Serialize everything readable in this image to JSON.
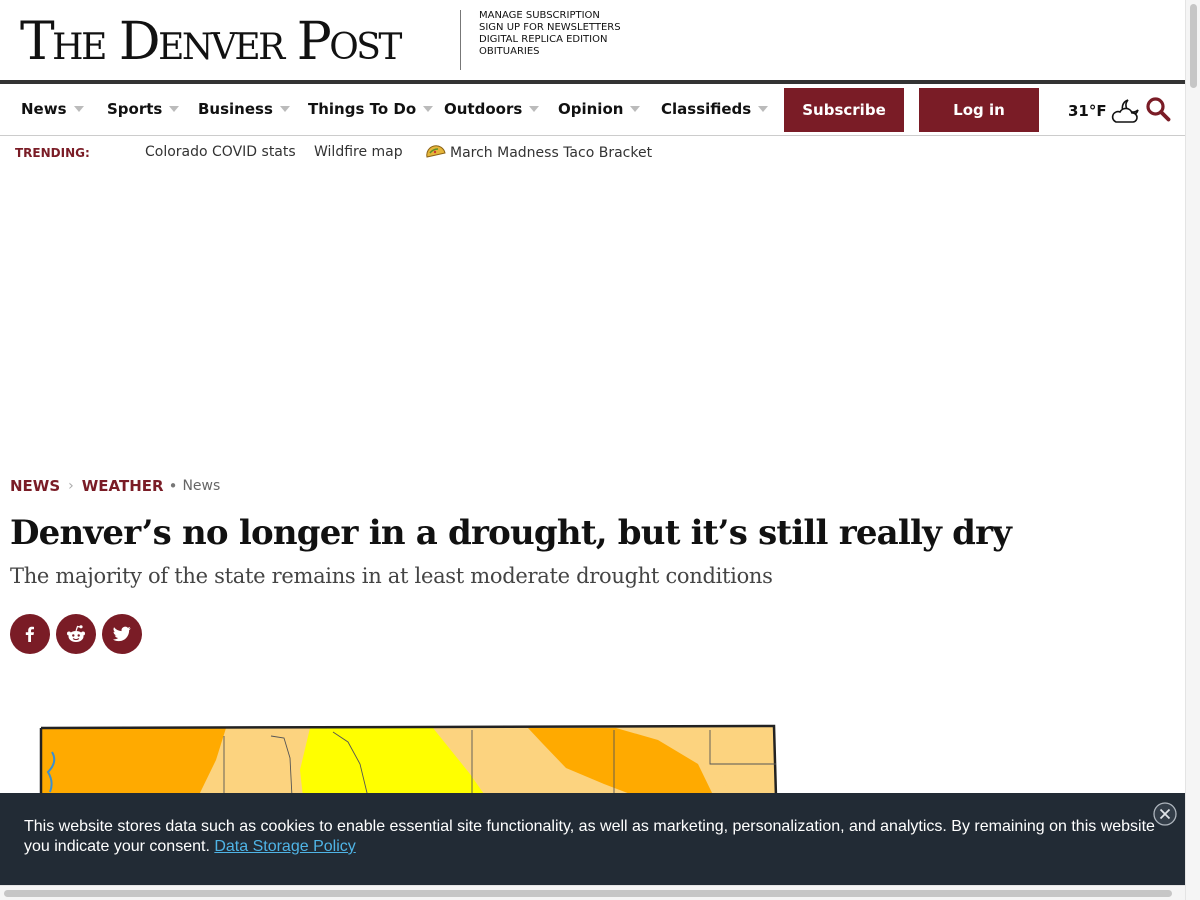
{
  "masthead": {
    "logo": "The Denver Post",
    "links": [
      "Manage Subscription",
      "Sign Up For Newsletters",
      "Digital Replica Edition",
      "Obituaries"
    ]
  },
  "nav": {
    "items": [
      "News",
      "Sports",
      "Business",
      "Things To Do",
      "Outdoors",
      "Opinion",
      "Classifieds"
    ],
    "subscribe_label": "Subscribe",
    "login_label": "Log in",
    "temperature": "31°F",
    "weather_icon": "partly-cloudy-night-icon",
    "search_icon": "search-icon"
  },
  "trending": {
    "label": "TRENDING:",
    "links": [
      "Colorado COVID stats",
      "Wildfire map",
      "March Madness Taco Bracket"
    ]
  },
  "article": {
    "breadcrumb": [
      "NEWS",
      "WEATHER"
    ],
    "section": "News",
    "headline": "Denver’s no longer in a drought, but it’s still really dry",
    "dek": "The majority of the state remains in at least moderate drought conditions",
    "share_icons": [
      "facebook-icon",
      "reddit-icon",
      "twitter-icon"
    ]
  },
  "cookie_banner": {
    "text": "This website stores data such as cookies to enable essential site functionality, as well as marketing, personalization, and analytics. By remaining on this website you indicate your consent.",
    "link_text": "Data Storage Policy"
  },
  "colors": {
    "brand": "#7a1c26",
    "banner_bg": "#222b35",
    "link": "#4fb4e6",
    "drought_d0": "#ffff00",
    "drought_d1": "#fcd37f",
    "drought_d2": "#ffaa00"
  }
}
